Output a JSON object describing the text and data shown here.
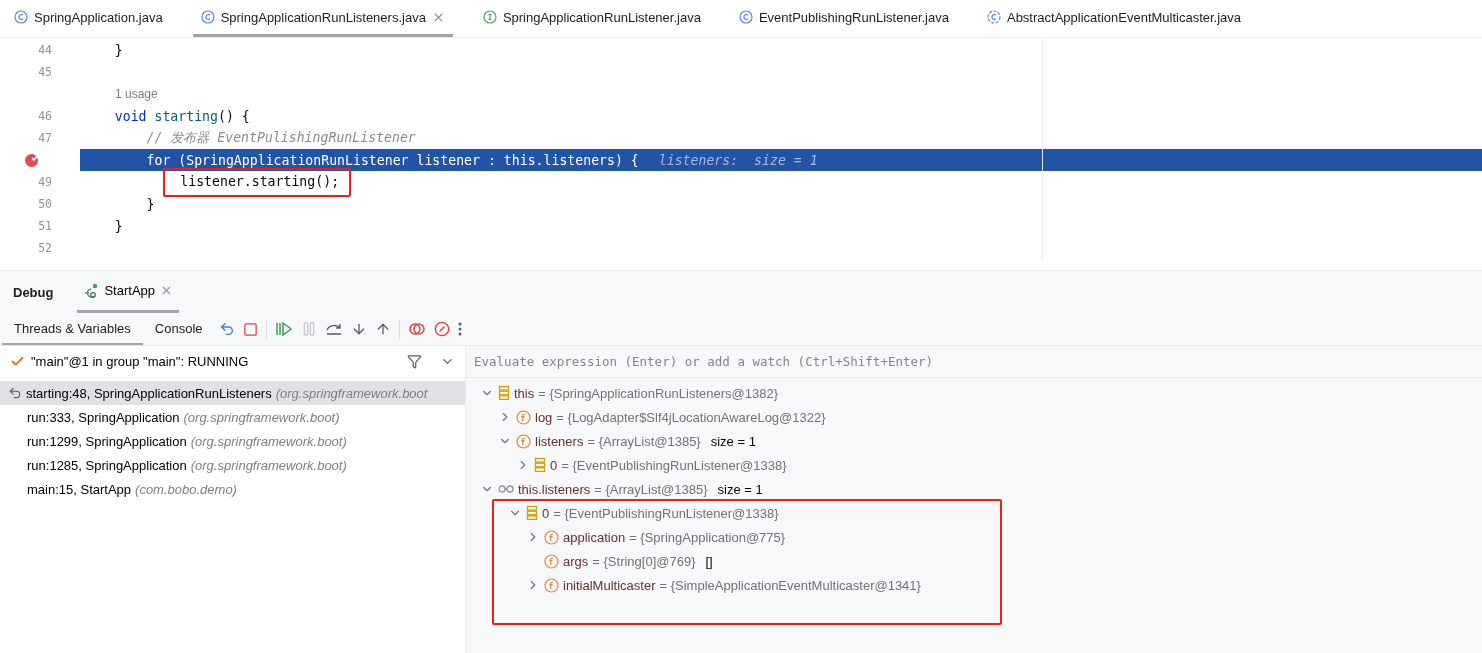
{
  "editor_tabs": [
    {
      "label": "SpringApplication.java",
      "kind": "class",
      "selected": false
    },
    {
      "label": "SpringApplicationRunListeners.java",
      "kind": "class",
      "selected": true
    },
    {
      "label": "SpringApplicationRunListener.java",
      "kind": "interface",
      "selected": false
    },
    {
      "label": "EventPublishingRunListener.java",
      "kind": "class",
      "selected": false
    },
    {
      "label": "AbstractApplicationEventMulticaster.java",
      "kind": "abstract",
      "selected": false
    }
  ],
  "code_lines": [
    {
      "kind": "code",
      "number": "44",
      "tokens": [
        {
          "kind": "plain",
          "text": "    }"
        }
      ]
    },
    {
      "kind": "code",
      "number": "45"
    },
    {
      "kind": "usage",
      "text": "1 usage"
    },
    {
      "kind": "code",
      "number": "46",
      "tokens": [
        {
          "kind": "keyword",
          "text": "    void "
        },
        {
          "kind": "method",
          "text": "starting"
        },
        {
          "kind": "plain",
          "text": "() {"
        }
      ]
    },
    {
      "kind": "code",
      "number": "47",
      "tokens": [
        {
          "kind": "comment",
          "text": "        // 发布器 EventPulishingRunListener"
        }
      ]
    },
    {
      "kind": "code",
      "breakpoint": true,
      "current": true,
      "tokens": [
        {
          "kind": "keyword",
          "text": "        for "
        },
        {
          "kind": "plain",
          "text": "(SpringApplicationRunListener listener : this.listeners) {"
        }
      ],
      "hint": "listeners:  size = 1"
    },
    {
      "kind": "code",
      "number": "49",
      "annotated": true,
      "tokens": [
        {
          "kind": "plain",
          "text": "            listener.starting();"
        }
      ]
    },
    {
      "kind": "code",
      "number": "50",
      "tokens": [
        {
          "kind": "plain",
          "text": "        }"
        }
      ]
    },
    {
      "kind": "code",
      "number": "51",
      "tokens": [
        {
          "kind": "plain",
          "text": "    }"
        }
      ]
    },
    {
      "kind": "code",
      "number": "52"
    }
  ],
  "debug": {
    "title": "Debug",
    "session_tab": {
      "label": "StartApp",
      "selected": true
    },
    "view_tabs": [
      {
        "label": "Threads & Variables",
        "selected": true
      },
      {
        "label": "Console",
        "selected": false
      }
    ],
    "toolbar": [
      {
        "kind": "rerun",
        "disabled": false
      },
      {
        "kind": "stop",
        "disabled": false
      },
      {
        "kind": "resume",
        "disabled": false
      },
      {
        "kind": "pause",
        "disabled": true
      },
      {
        "kind": "step_over",
        "disabled": false
      },
      {
        "kind": "step_into",
        "disabled": false
      },
      {
        "kind": "step_out",
        "disabled": false
      },
      {
        "kind": "breakpoints",
        "disabled": false
      },
      {
        "kind": "mute",
        "disabled": false
      },
      {
        "kind": "more",
        "disabled": false
      }
    ],
    "thread": {
      "label": "\"main\"@1 in group \"main\": RUNNING"
    },
    "frames": [
      {
        "method": "starting:48, SpringApplicationRunListeners",
        "location": "(org.springframework.boot",
        "selected": true
      },
      {
        "method": "run:333, SpringApplication",
        "location": "(org.springframework.boot)",
        "selected": false
      },
      {
        "method": "run:1299, SpringApplication",
        "location": "(org.springframework.boot)",
        "selected": false
      },
      {
        "method": "run:1285, SpringApplication",
        "location": "(org.springframework.boot)",
        "selected": false
      },
      {
        "method": "main:15, StartApp",
        "location": "(com.bobo.demo)",
        "selected": false
      }
    ],
    "evaluate": {
      "placeholder": "Evaluate expression (Enter) or add a watch (Ctrl+Shift+Enter)"
    },
    "variables": [
      {
        "kind": "object",
        "name": "this",
        "value": "= {SpringApplicationRunListeners@1382}",
        "expanded": true,
        "children": [
          {
            "kind": "field",
            "name": "log",
            "value": "= {LogAdapter$Slf4jLocationAwareLog@1322}",
            "expanded": false
          },
          {
            "kind": "field",
            "name": "listeners",
            "value": "= {ArrayList@1385}",
            "extra": "size = 1",
            "expanded": true,
            "children": [
              {
                "kind": "object",
                "name": "0",
                "value": "= {EventPublishingRunListener@1338}",
                "expanded": false
              }
            ]
          }
        ]
      },
      {
        "kind": "watch",
        "name": "this.listeners",
        "value": "= {ArrayList@1385}",
        "extra": "size = 1",
        "expanded": true,
        "children": [
          {
            "kind": "object",
            "name": "0",
            "value": "= {EventPublishingRunListener@1338}",
            "expanded": true,
            "annotated": true,
            "children": [
              {
                "kind": "field",
                "name": "application",
                "value": "= {SpringApplication@775}",
                "expanded": false
              },
              {
                "kind": "field",
                "name": "args",
                "value": "= {String[0]@769}",
                "extra": "[]"
              },
              {
                "kind": "field",
                "name": "initialMulticaster",
                "value": "= {SimpleApplicationEventMulticaster@1341}",
                "expanded": false
              }
            ]
          }
        ]
      }
    ]
  }
}
